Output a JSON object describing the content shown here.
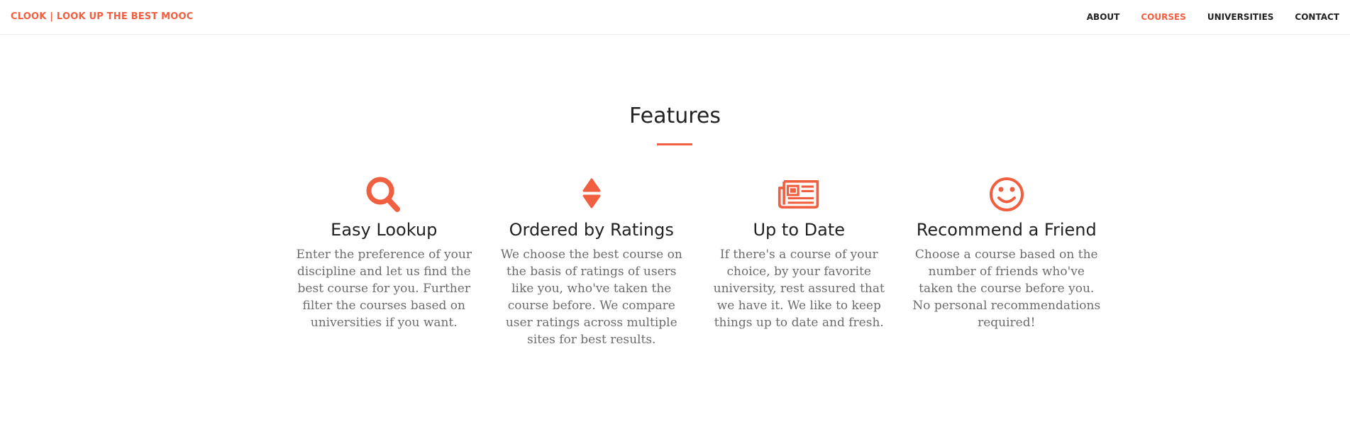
{
  "navbar": {
    "brand": "CLOOK | LOOK UP THE BEST MOOC",
    "items": [
      {
        "label": "ABOUT"
      },
      {
        "label": "COURSES"
      },
      {
        "label": "UNIVERSITIES"
      },
      {
        "label": "CONTACT"
      }
    ],
    "active_item": "COURSES"
  },
  "section": {
    "title": "Features"
  },
  "features": [
    {
      "icon": "search-icon",
      "title": "Easy Lookup",
      "text": "Enter the preference of your discipline and let us find the best course for you. Further filter the courses based on universities if you want."
    },
    {
      "icon": "sort-icon",
      "title": "Ordered by Ratings",
      "text": "We choose the best course on the basis of ratings of users like you, who've taken the course before. We compare user ratings across multiple sites for best results."
    },
    {
      "icon": "newspaper-icon",
      "title": "Up to Date",
      "text": "If there's a course of your choice, by your favorite university, rest assured that we have it. We like to keep things up to date and fresh."
    },
    {
      "icon": "smile-icon",
      "title": "Recommend a Friend",
      "text": "Choose a course based on the number of friends who've taken the course before you. No personal recommendations required!"
    }
  ],
  "colors": {
    "accent": "#f05f40",
    "heading": "#222222",
    "body_text": "#6c6c6c"
  }
}
